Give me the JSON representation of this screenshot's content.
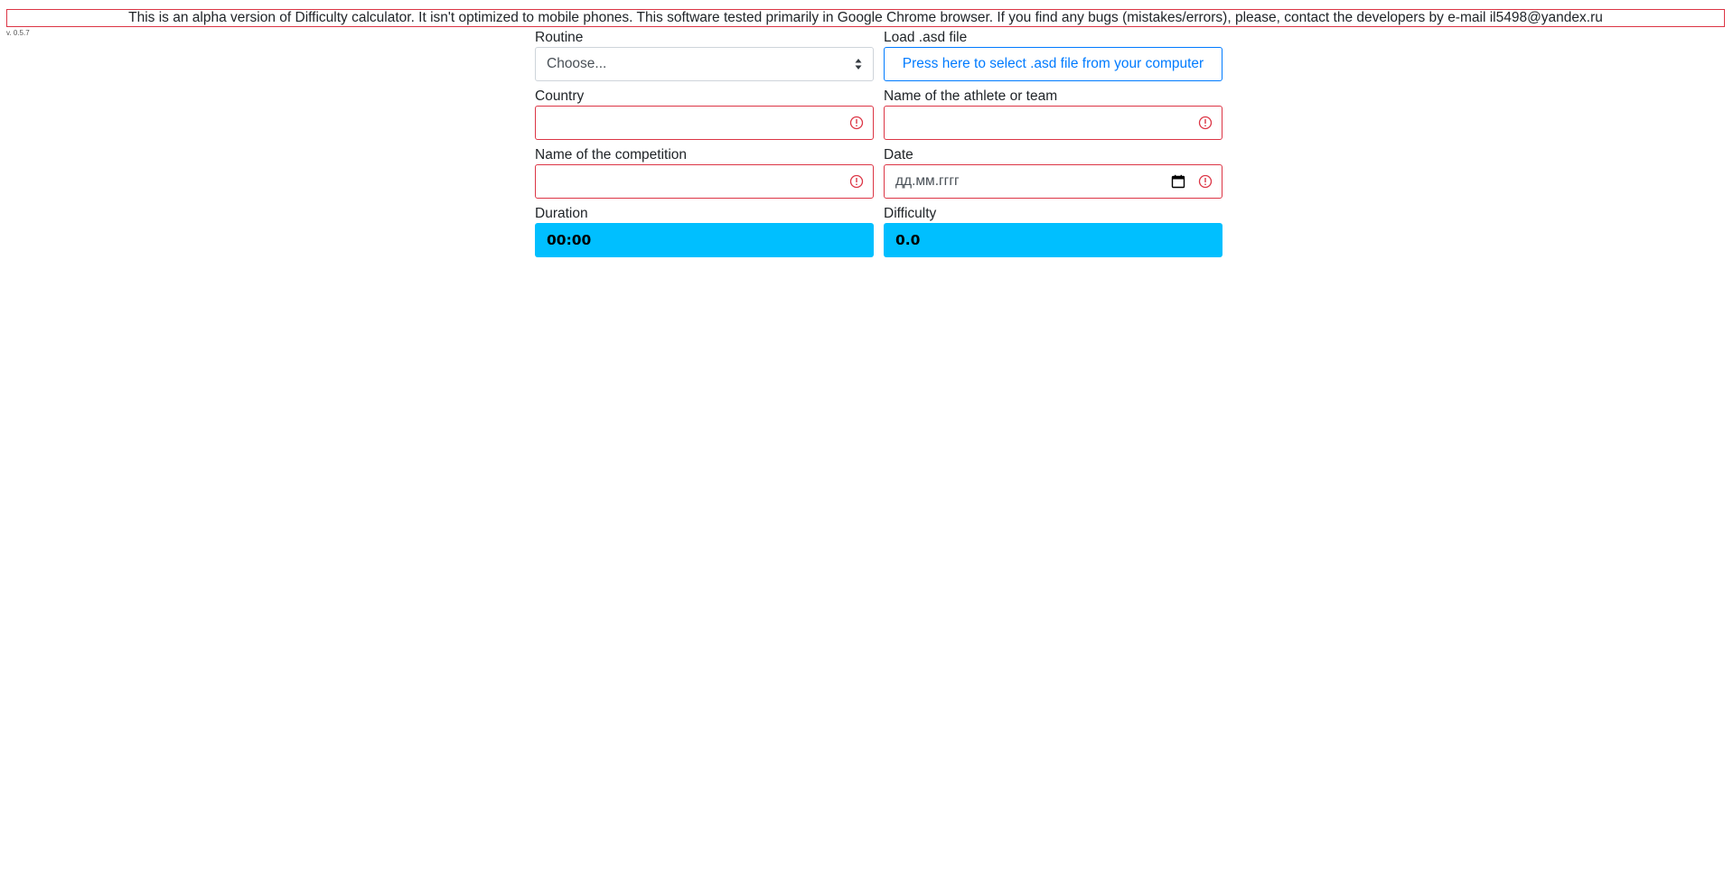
{
  "banner": {
    "text": "This is an alpha version of Difficulty calculator. It isn't optimized to mobile phones. This software tested primarily in Google Chrome browser. If you find any bugs (mistakes/errors), please, contact the developers by e-mail il5498@yandex.ru"
  },
  "version": "v. 0.5.7",
  "form": {
    "routine": {
      "label": "Routine",
      "selected": "Choose..."
    },
    "load_file": {
      "label": "Load .asd file",
      "button_label": "Press here to select .asd file from your computer"
    },
    "country": {
      "label": "Country",
      "value": ""
    },
    "athlete": {
      "label": "Name of the athlete or team",
      "value": ""
    },
    "competition": {
      "label": "Name of the competition",
      "value": ""
    },
    "date": {
      "label": "Date",
      "placeholder": "дд.мм.гггг"
    },
    "duration": {
      "label": "Duration",
      "value": "00:00"
    },
    "difficulty": {
      "label": "Difficulty",
      "value": "0.0"
    }
  },
  "colors": {
    "invalid": "#dc3545",
    "primary": "#007bff",
    "output_bg": "#00bfff"
  },
  "icons": {
    "invalid": "exclamation-circle-icon",
    "select": "sort-arrows-icon",
    "calendar": "calendar-icon"
  }
}
